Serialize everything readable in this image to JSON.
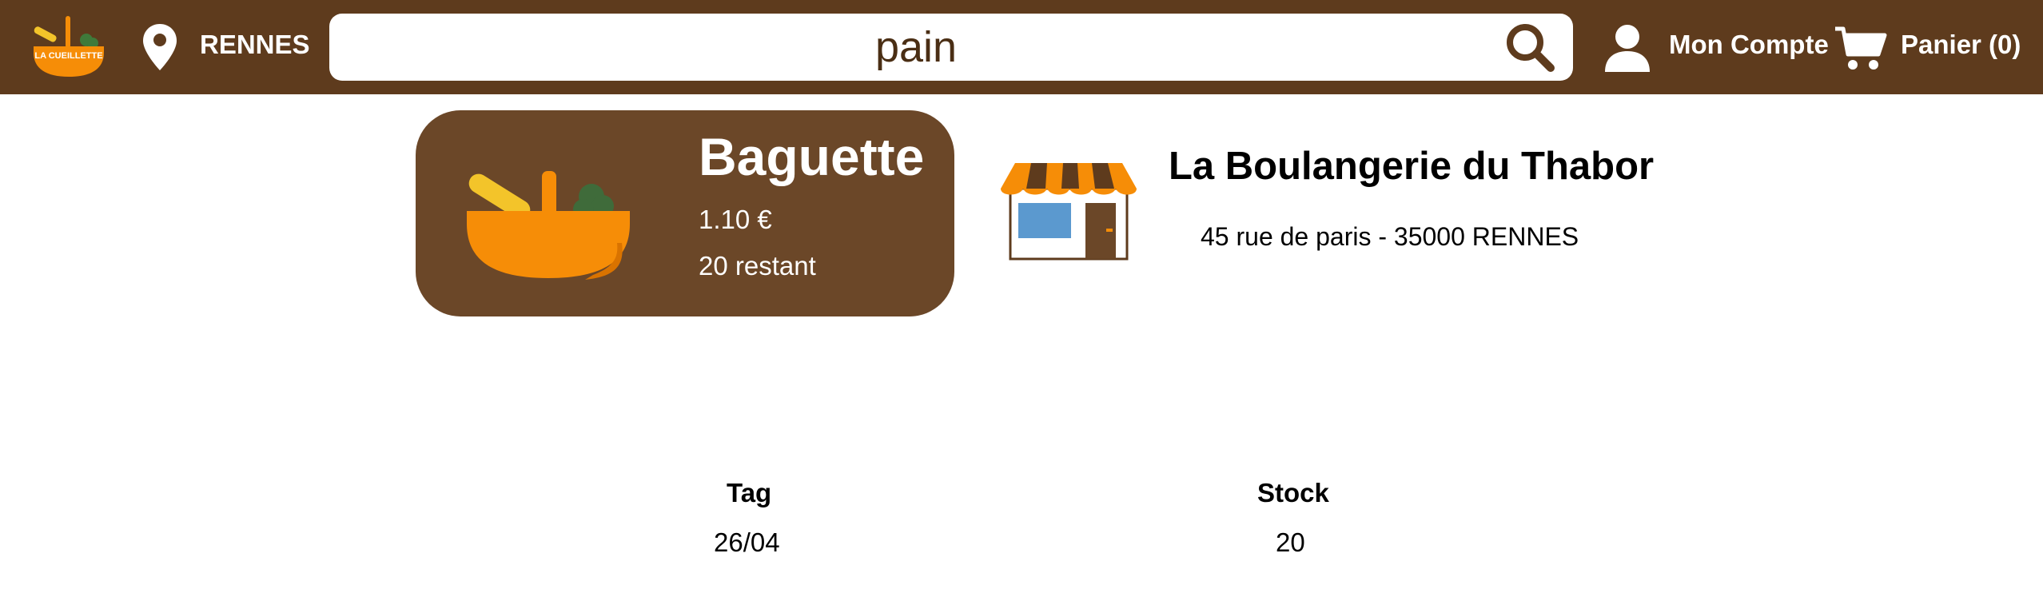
{
  "header": {
    "logo_text": "LA CUEILLETTE",
    "city": "RENNES",
    "search_value": "pain",
    "account_label": "Mon Compte",
    "cart_label": "Panier (0)"
  },
  "product": {
    "name": "Baguette",
    "price": "1.10 €",
    "stock": "20 restant"
  },
  "shop": {
    "name": "La Boulangerie du Thabor",
    "address": "45 rue de paris - 35000 RENNES"
  },
  "table": {
    "headers": [
      "Tag",
      "Stock"
    ],
    "rows": [
      [
        "26/04",
        "20"
      ]
    ]
  },
  "colors": {
    "header_bg": "#5e3b1d",
    "card_bg": "#6b4728",
    "accent_orange": "#f68d07"
  }
}
